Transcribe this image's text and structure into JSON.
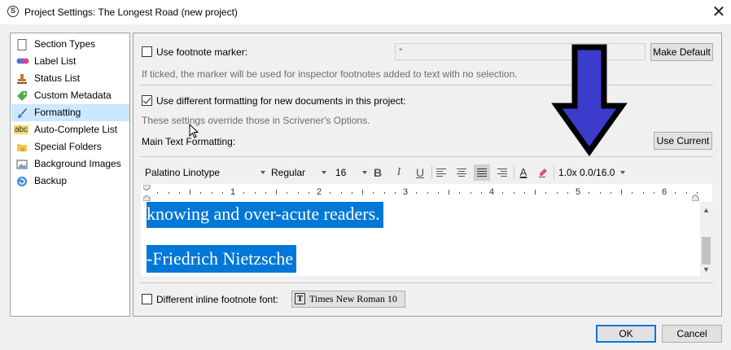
{
  "window": {
    "title": "Project Settings: The Longest Road (new project)",
    "app_icon_glyph": "S",
    "close_glyph": "✕"
  },
  "sidebar": {
    "items": [
      {
        "label": "Section Types",
        "icon": "document-icon",
        "selected": false
      },
      {
        "label": "Label List",
        "icon": "label-dots-icon",
        "selected": false
      },
      {
        "label": "Status List",
        "icon": "stamp-icon",
        "selected": false
      },
      {
        "label": "Custom Metadata",
        "icon": "tag-icon",
        "selected": false
      },
      {
        "label": "Formatting",
        "icon": "brush-icon",
        "selected": true
      },
      {
        "label": "Auto-Complete List",
        "icon": "abc-icon",
        "selected": false
      },
      {
        "label": "Special Folders",
        "icon": "folder-star-icon",
        "selected": false
      },
      {
        "label": "Background Images",
        "icon": "image-icon",
        "selected": false
      },
      {
        "label": "Backup",
        "icon": "backup-icon",
        "selected": false
      }
    ]
  },
  "footnote_marker": {
    "checked": false,
    "label": "Use footnote marker:",
    "value": "*",
    "make_default_label": "Make Default",
    "hint": "If ticked, the marker will be used for inspector footnotes added to text with no selection."
  },
  "diff_formatting": {
    "checked": true,
    "label": "Use different formatting for new documents in this project:",
    "hint": "These settings override those in Scrivener's Options.",
    "main_text_label": "Main Text Formatting:",
    "use_current_label": "Use Current"
  },
  "toolbar": {
    "font_family": "Palatino Linotype",
    "font_style": "Regular",
    "font_size": "16",
    "bold": "B",
    "italic": "I",
    "underline": "U",
    "text_color_glyph": "A",
    "spacing": "1.0x 0.0/16.0"
  },
  "ruler": {
    "numbers": [
      "1",
      "2",
      "3",
      "4",
      "5",
      "6"
    ]
  },
  "editor": {
    "lines": [
      "knowing and over-acute readers.",
      "-Friedrich Nietzsche"
    ]
  },
  "inline_footnote": {
    "checked": false,
    "label": "Different inline footnote font:",
    "font_button": "Times New Roman 10",
    "font_icon_glyph": "T"
  },
  "footer": {
    "ok_label": "OK",
    "cancel_label": "Cancel"
  },
  "colors": {
    "selection": "#0078d7",
    "sidebar_selected": "#cce8ff",
    "arrow_fill": "#3b3bcc"
  }
}
